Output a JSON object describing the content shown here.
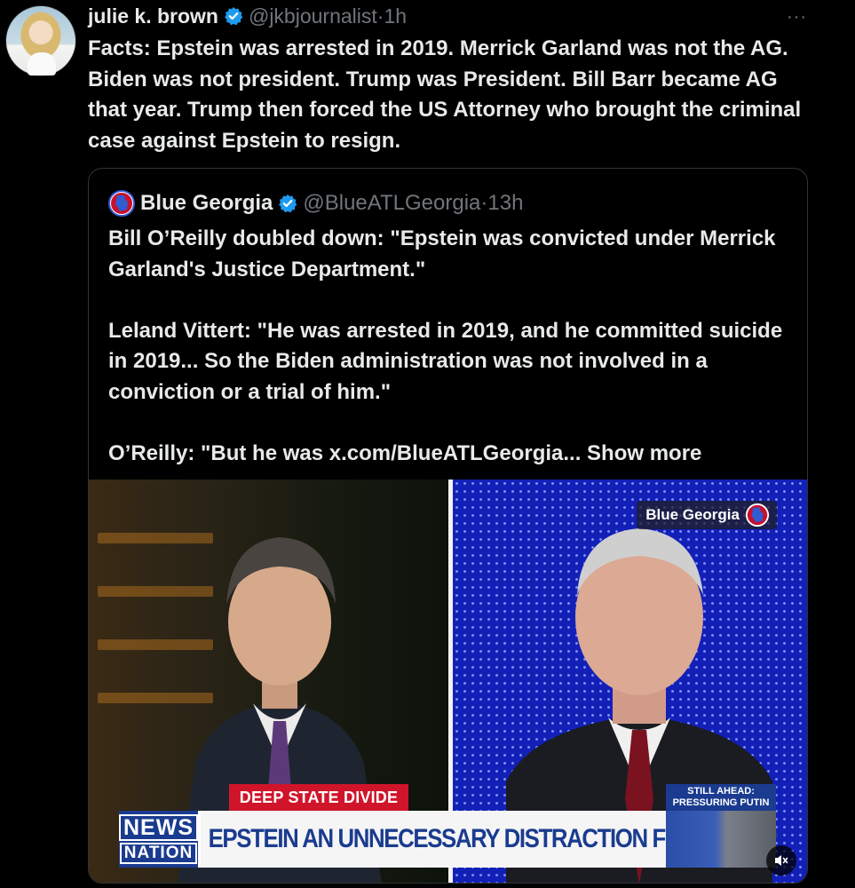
{
  "tweet": {
    "author_name": "julie k. brown",
    "handle": "@jkbjournalist",
    "separator": "·",
    "time": "1h",
    "more": "···",
    "text": "Facts: Epstein was arrested in 2019. Merrick Garland was not the AG. Biden was not president. Trump was President. Bill Barr became AG that year. Trump then forced the US Attorney who brought the criminal case against Epstein to resign."
  },
  "quote": {
    "author_name": "Blue Georgia",
    "handle": "@BlueATLGeorgia",
    "separator": "·",
    "time": "13h",
    "paragraph_1": "Bill O’Reilly doubled down: \"Epstein was convicted under Merrick Garland's Justice Department.\"",
    "paragraph_2": "Leland Vittert: \"He was arrested in 2019, and he committed suicide in 2019... So the Biden administration was not involved in a conviction or a trial of him.\"",
    "paragraph_3": "O’Reilly: \"But he was x.com/BlueATLGeorgia...",
    "show_more": "Show more"
  },
  "media": {
    "watermark": "Blue Georgia",
    "ticker_tag": "DEEP STATE DIVIDE",
    "network_logo_line1": "NEWS",
    "network_logo_line2": "NATION",
    "headline": "EPSTEIN AN UNNECESSARY DISTRACTION FOR TRUMP",
    "still_ahead_line1": "STILL AHEAD:",
    "still_ahead_line2": "PRESSURING PUTIN"
  },
  "colors": {
    "background": "#000000",
    "text": "#e7e9ea",
    "muted": "#71767b",
    "verified": "#1d9bf0",
    "ticker_red": "#d0152a",
    "newsnation_blue": "#1a3b8f"
  },
  "icons": [
    "verified-badge-icon",
    "blue-georgia-logo-icon",
    "more-icon",
    "mute-icon"
  ]
}
